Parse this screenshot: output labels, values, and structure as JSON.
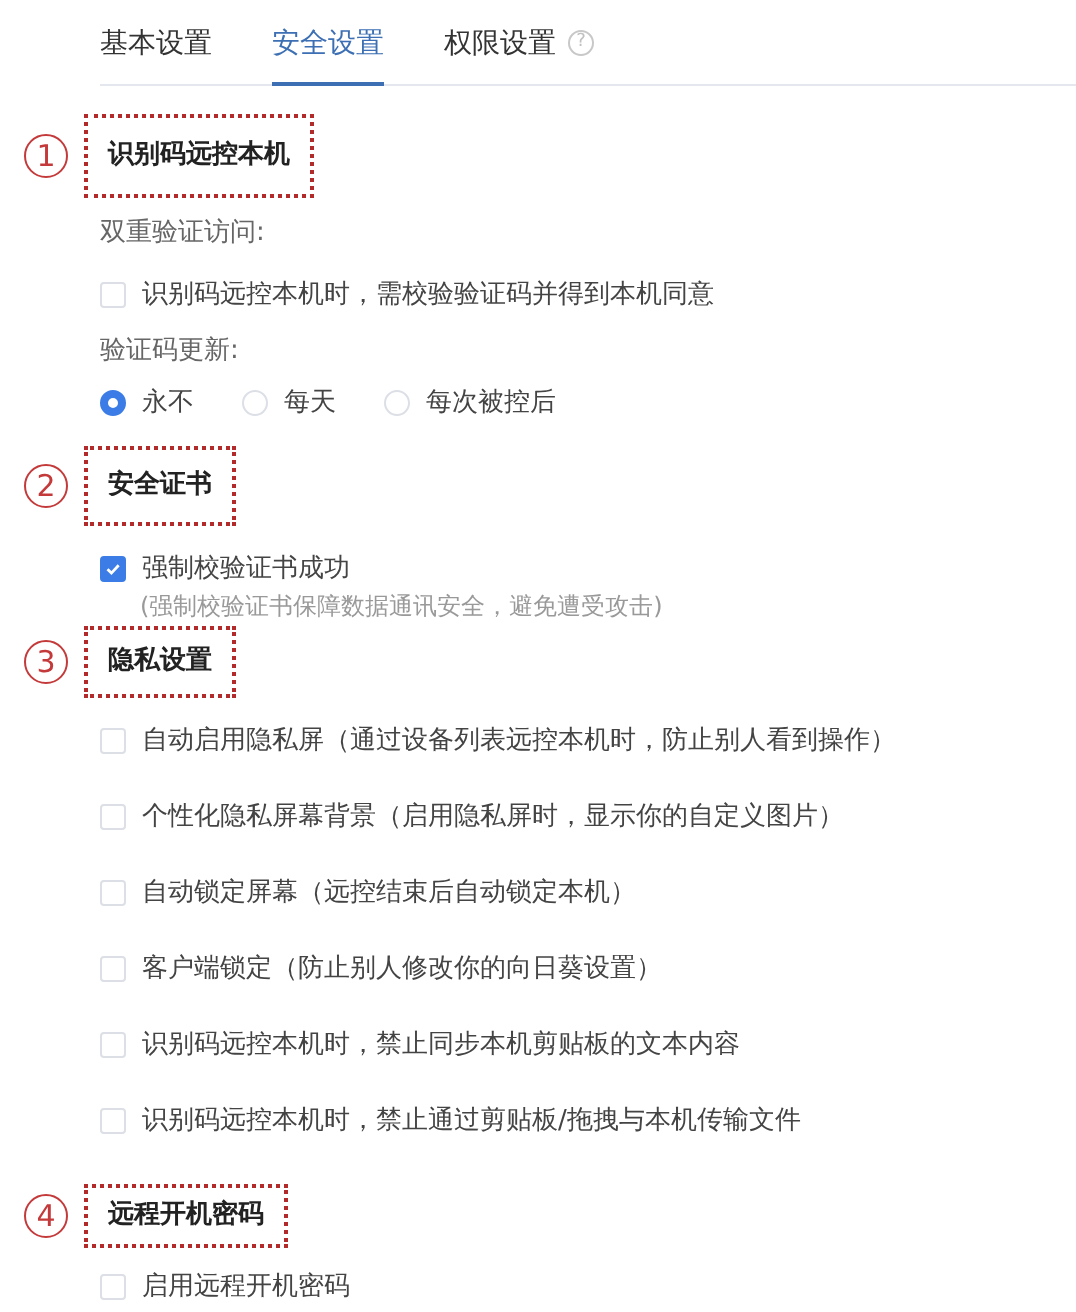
{
  "tabs": [
    {
      "label": "基本设置",
      "selected": false
    },
    {
      "label": "安全设置",
      "selected": true
    },
    {
      "label": "权限设置",
      "selected": false,
      "help": "?"
    }
  ],
  "sections": [
    {
      "marker": "1",
      "title": "识别码远控本机",
      "blocks": [
        {
          "kind": "label",
          "text": "双重验证访问:"
        },
        {
          "kind": "checkbox",
          "label": "识别码远控本机时，需校验验证码并得到本机同意",
          "checked": false
        },
        {
          "kind": "label",
          "text": "验证码更新:"
        },
        {
          "kind": "radios",
          "options": [
            {
              "label": "永不",
              "selected": true
            },
            {
              "label": "每天",
              "selected": false
            },
            {
              "label": "每次被控后",
              "selected": false
            }
          ]
        }
      ]
    },
    {
      "marker": "2",
      "title": "安全证书",
      "blocks": [
        {
          "kind": "checkbox",
          "label": "强制校验证书成功",
          "checked": true,
          "hint": "(强制校验证书保障数据通讯安全，避免遭受攻击)"
        }
      ]
    },
    {
      "marker": "3",
      "title": "隐私设置",
      "blocks": [
        {
          "kind": "checkbox",
          "label": "自动启用隐私屏（通过设备列表远控本机时，防止别人看到操作）",
          "checked": false
        },
        {
          "kind": "checkbox",
          "label": "个性化隐私屏幕背景（启用隐私屏时，显示你的自定义图片）",
          "checked": false
        },
        {
          "kind": "checkbox",
          "label": "自动锁定屏幕（远控结束后自动锁定本机）",
          "checked": false
        },
        {
          "kind": "checkbox",
          "label": "客户端锁定（防止别人修改你的向日葵设置）",
          "checked": false
        },
        {
          "kind": "checkbox",
          "label": "识别码远控本机时，禁止同步本机剪贴板的文本内容",
          "checked": false
        },
        {
          "kind": "checkbox",
          "label": "识别码远控本机时，禁止通过剪贴板/拖拽与本机传输文件",
          "checked": false
        }
      ]
    },
    {
      "marker": "4",
      "title": "远程开机密码",
      "blocks": [
        {
          "kind": "checkbox",
          "label": "启用远程开机密码",
          "checked": false
        }
      ]
    }
  ]
}
